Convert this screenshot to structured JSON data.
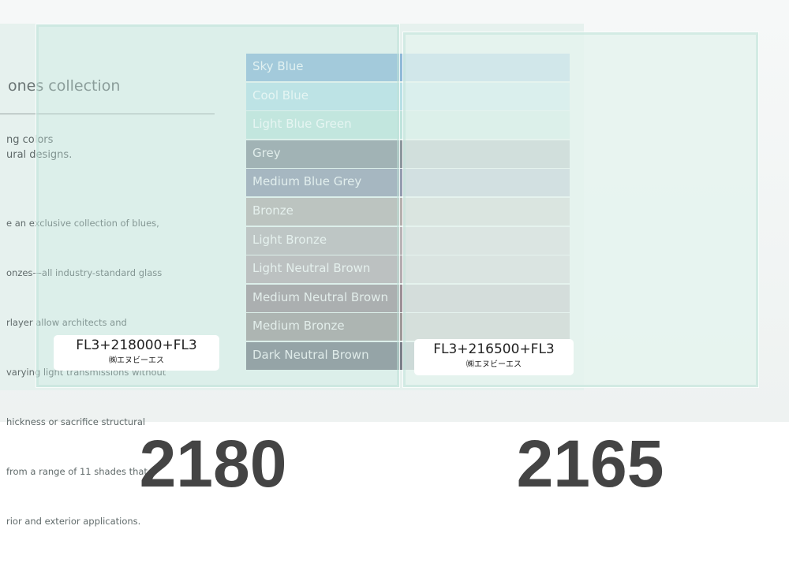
{
  "brochure": {
    "title": "ones collection",
    "subtitle": [
      "ng colors",
      "ural designs."
    ],
    "body": [
      "e an exclusive collection of blues,",
      "onzes—all industry-standard glass",
      "rlayer allow architects and",
      "varying light transmissions without",
      "hickness or sacrifice structural",
      "from a range of 11 shades that",
      "rior and exterior applications."
    ],
    "swatches": [
      {
        "label": "Sky Blue",
        "color": "#8fb9d8"
      },
      {
        "label": "Cool Blue",
        "color": "#b7dfe6"
      },
      {
        "label": "Light Blue Green",
        "color": "#bfe3dc"
      },
      {
        "label": "Grey",
        "color": "#8c969d"
      },
      {
        "label": "Medium Blue Grey",
        "color": "#949cb0"
      },
      {
        "label": "Bronze",
        "color": "#b6b0ae"
      },
      {
        "label": "Light Bronze",
        "color": "#b9b3b6"
      },
      {
        "label": "Light Neutral Brown",
        "color": "#b5abb0"
      },
      {
        "label": "Medium Neutral Brown",
        "color": "#9c8f96"
      },
      {
        "label": "Medium Bronze",
        "color": "#9e9898"
      },
      {
        "label": "Dark Neutral Brown",
        "color": "#7a7e88"
      }
    ]
  },
  "samples": [
    {
      "code": "FL3+218000+FL3",
      "maker": "㈱エヌビーエス",
      "number": "2180"
    },
    {
      "code": "FL3+216500+FL3",
      "maker": "㈱エヌビーエス",
      "number": "2165"
    }
  ]
}
